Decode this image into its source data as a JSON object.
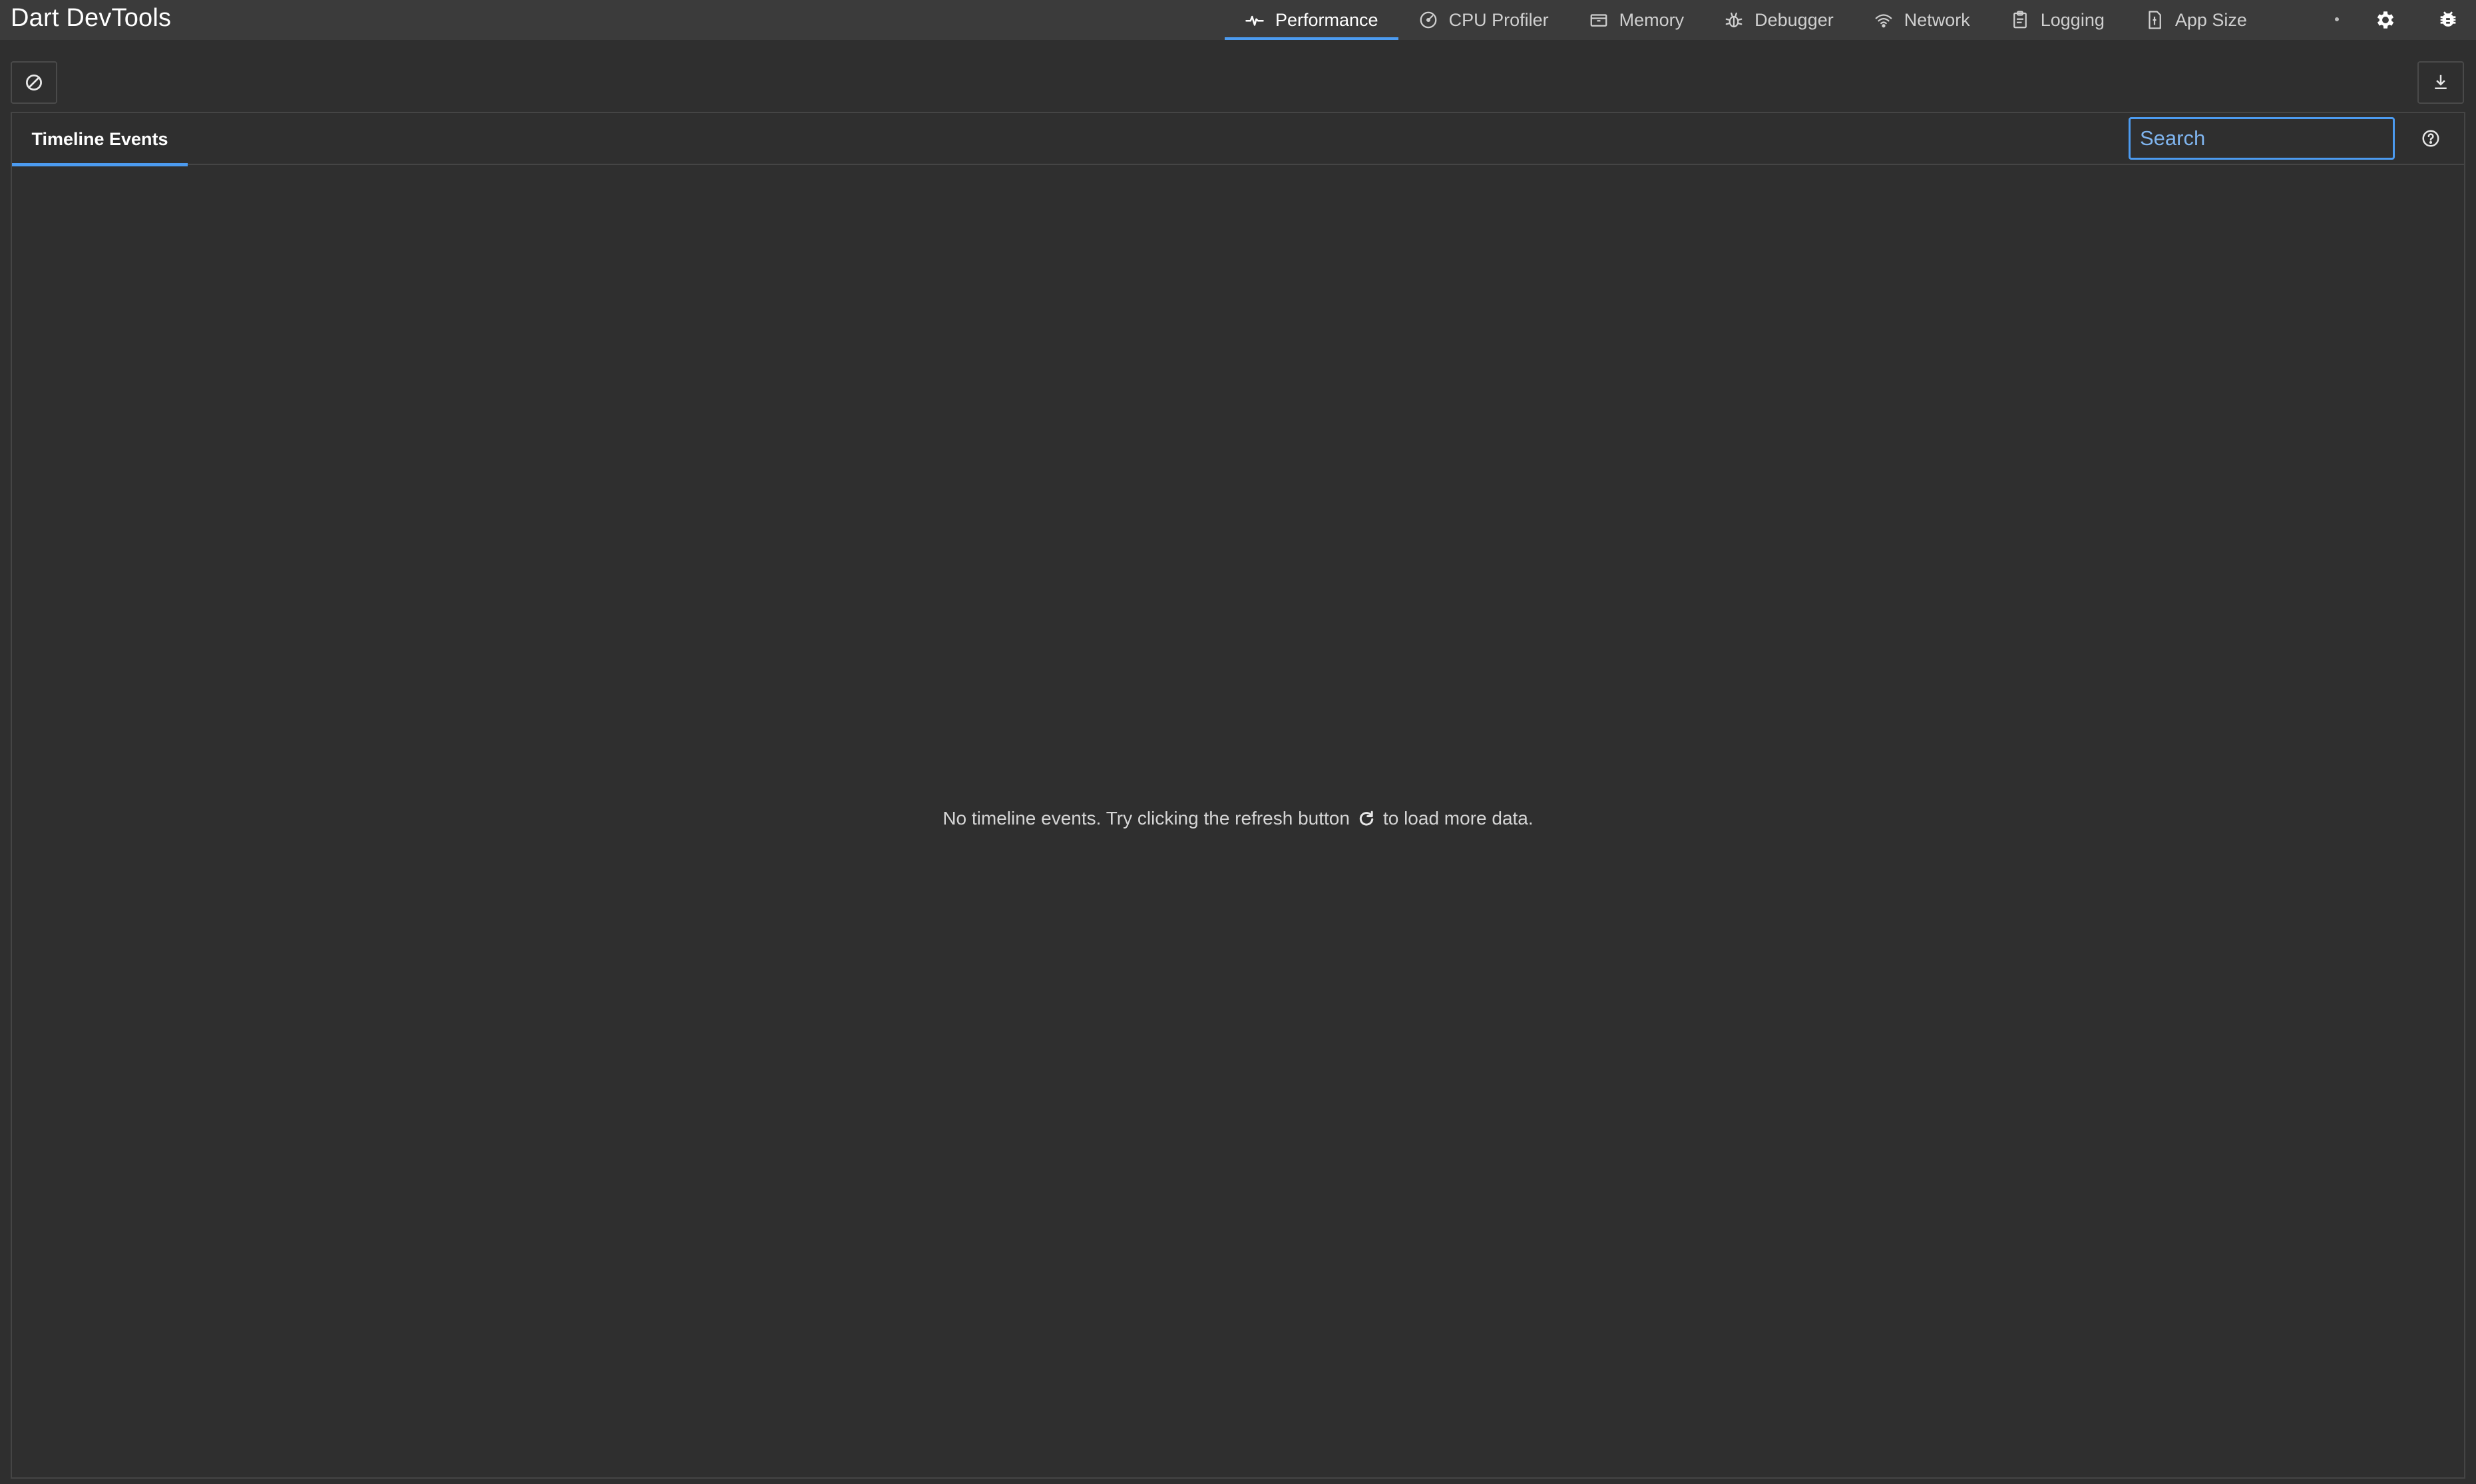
{
  "app": {
    "title": "Dart DevTools"
  },
  "nav": {
    "tabs": [
      {
        "label": "Performance",
        "icon": "performance-icon",
        "active": true
      },
      {
        "label": "CPU Profiler",
        "icon": "cpu-profiler-icon",
        "active": false
      },
      {
        "label": "Memory",
        "icon": "memory-icon",
        "active": false
      },
      {
        "label": "Debugger",
        "icon": "debugger-icon",
        "active": false
      },
      {
        "label": "Network",
        "icon": "network-icon",
        "active": false
      },
      {
        "label": "Logging",
        "icon": "logging-icon",
        "active": false
      },
      {
        "label": "App Size",
        "icon": "app-size-icon",
        "active": false
      }
    ],
    "actions": {
      "settings_icon": "gear-icon",
      "bug_icon": "bug-icon"
    }
  },
  "toolbar": {
    "clear_icon": "clear-icon",
    "export_icon": "download-icon"
  },
  "panel": {
    "tab_label": "Timeline Events",
    "search": {
      "placeholder": "Search",
      "value": ""
    },
    "help_icon": "help-icon",
    "empty": {
      "before": "No timeline events. Try clicking the refresh button",
      "icon": "refresh-icon",
      "after": "to load more data."
    }
  },
  "colors": {
    "background": "#2f2f2f",
    "appbar": "#3b3b3b",
    "accent": "#4c9bf0",
    "border": "#454545"
  }
}
